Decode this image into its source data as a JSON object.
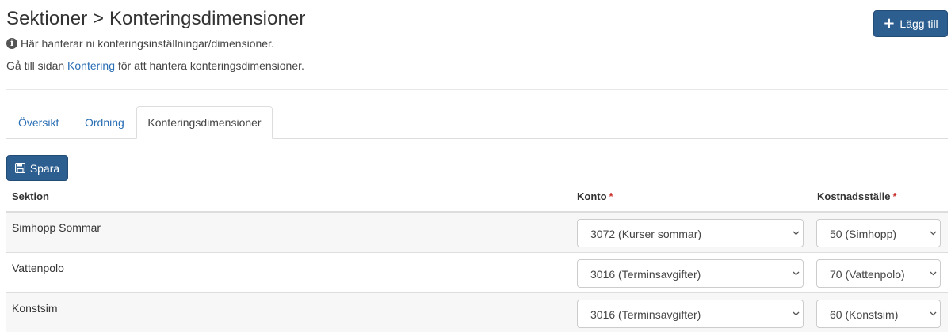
{
  "header": {
    "title": "Sektioner > Konteringsdimensioner",
    "info": "Här hanterar ni konteringsinställningar/dimensioner.",
    "goto_prefix": "Gå till sidan ",
    "goto_link": "Kontering",
    "goto_suffix": " för att hantera konteringsdimensioner.",
    "add_label": "Lägg till"
  },
  "tabs": [
    {
      "label": "Översikt",
      "active": false
    },
    {
      "label": "Ordning",
      "active": false
    },
    {
      "label": "Konteringsdimensioner",
      "active": true
    }
  ],
  "toolbar": {
    "save_label": "Spara"
  },
  "table": {
    "columns": [
      {
        "label": "Sektion",
        "required": false
      },
      {
        "label": "Konto",
        "required": true
      },
      {
        "label": "Kostnadsställe",
        "required": true
      }
    ],
    "required_marker": "*",
    "rows": [
      {
        "sektion": "Simhopp Sommar",
        "konto": "3072 (Kurser sommar)",
        "kostnadsstalle": "50 (Simhopp)"
      },
      {
        "sektion": "Vattenpolo",
        "konto": "3016 (Terminsavgifter)",
        "kostnadsstalle": "70 (Vattenpolo)"
      },
      {
        "sektion": "Konstsim",
        "konto": "3016 (Terminsavgifter)",
        "kostnadsstalle": "60 (Konstsim)"
      }
    ]
  },
  "colors": {
    "primary_button": "#2c5e8f",
    "link": "#2a6eb4",
    "required": "#c9302c",
    "row_stripe": "#f7f7f7"
  },
  "icons": {
    "info": "info-circle-icon",
    "add": "plus-icon",
    "save": "floppy-disk-icon",
    "dropdown": "chevron-down-icon"
  }
}
